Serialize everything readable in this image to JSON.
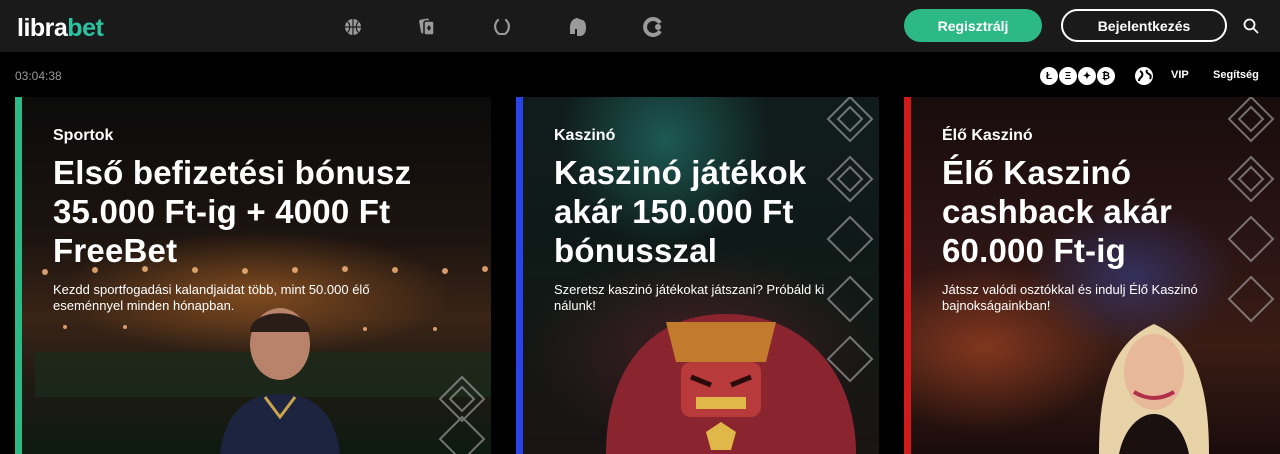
{
  "brand": {
    "logo_part1": "libra",
    "logo_part2": "bet",
    "accent": "#2bc4a3"
  },
  "nav": {
    "icons": [
      "basketball-icon",
      "cards-icon",
      "laurel-icon",
      "spartan-helmet-icon",
      "chips-icon"
    ]
  },
  "header": {
    "register_label": "Regisztrálj",
    "login_label": "Bejelentkezés",
    "register_color": "#2db887"
  },
  "subbar": {
    "time": "03:04:38",
    "crypto": [
      "Ł",
      "Ξ",
      "✦",
      "₿"
    ],
    "vip_label": "VIP",
    "help_label": "Segítség"
  },
  "cards": [
    {
      "category": "Sportok",
      "headline_lines": [
        "Első befizetési bónusz",
        "35.000 Ft-ig + 4000 Ft",
        "FreeBet"
      ],
      "desc_lines": [
        "Kezdd sportfogadási kalandjaidat több, mint 50.000 élő",
        "eseménnyel minden hónapban."
      ],
      "accent": "#2db887"
    },
    {
      "category": "Kaszinó",
      "headline_lines": [
        "Kaszinó játékok",
        "akár 150.000 Ft",
        "bónusszal"
      ],
      "desc_lines": [
        "Szeretsz kaszinó játékokat játszani? Próbáld ki",
        "nálunk!"
      ],
      "accent": "#2a43e8"
    },
    {
      "category": "Élő Kaszinó",
      "headline_lines": [
        "Élő Kaszinó",
        "cashback akár",
        "60.000 Ft-ig"
      ],
      "desc_lines": [
        "Játssz valódi osztókkal és indulj Élő Kaszinó",
        "bajnokságainkban!"
      ],
      "accent": "#d11a1a"
    }
  ]
}
